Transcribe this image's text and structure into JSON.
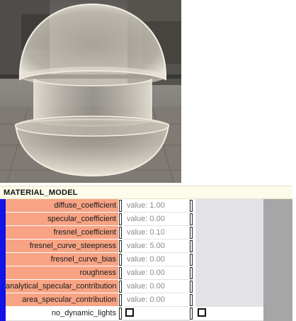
{
  "panel": {
    "title": "MATERIAL_MODEL"
  },
  "parameters": [
    {
      "name": "diffuse_coefficient",
      "value": "value: 1.00"
    },
    {
      "name": "specular_coefficient",
      "value": "value: 0.00"
    },
    {
      "name": "fresnel_coefficient",
      "value": "value: 0.10"
    },
    {
      "name": "fresnel_curve_steepness",
      "value": "value: 5.00"
    },
    {
      "name": "fresnel_curve_bias",
      "value": "value: 0.00"
    },
    {
      "name": "roughness",
      "value": "value: 0.00"
    },
    {
      "name": "analytical_specular_contribution",
      "value": "value: 0.00"
    },
    {
      "name": "area_specular_contribution",
      "value": "value: 0.00"
    }
  ],
  "toggle": {
    "name": "no_dynamic_lights",
    "checked": false
  },
  "colors": {
    "param_label_bg": "#f7a384",
    "header_bg": "#fdfbe9",
    "left_strip": "#1313e8",
    "gutter": "#a6a6a6"
  }
}
